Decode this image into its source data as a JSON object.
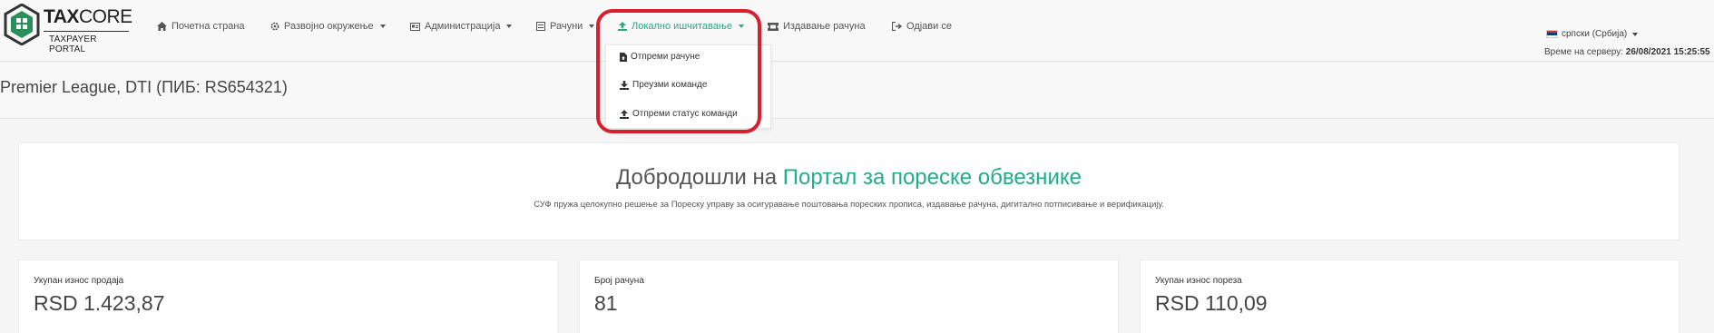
{
  "brand": {
    "title_bold": "TAX",
    "title_thin": "CORE",
    "subtitle": "TAXPAYER PORTAL",
    "logo_color": "#2b8f5a"
  },
  "nav": {
    "items": [
      {
        "label": "Почетна страна",
        "icon": "home-icon"
      },
      {
        "label": "Развојно окружење",
        "icon": "cog-icon",
        "has_caret": true
      },
      {
        "label": "Администрација",
        "icon": "id-card-icon",
        "has_caret": true
      },
      {
        "label": "Рачуни",
        "icon": "list-icon",
        "has_caret": true
      },
      {
        "label": "Локално ишчитавање",
        "icon": "upload-icon",
        "has_caret": true,
        "active": true
      },
      {
        "label": "Издавање рачуна",
        "icon": "ticket-icon"
      },
      {
        "label": "Одјави се",
        "icon": "sign-out-icon"
      }
    ],
    "active_color": "#2ea77a"
  },
  "language": {
    "label": "српски (Србија)",
    "flag": "serbian-flag-icon"
  },
  "server_time": {
    "label": "Време на серверу:",
    "value": "26/08/2021 15:25:55"
  },
  "dropdown": {
    "items": [
      {
        "label": "Отпреми рачуне",
        "icon": "file-upload-icon"
      },
      {
        "label": "Преузми команде",
        "icon": "download-icon"
      },
      {
        "label": "Отпреми статус команди",
        "icon": "upload-icon"
      }
    ],
    "highlight_color": "#d91f2e"
  },
  "company": {
    "name": "Premier League, DTI (ПИБ: RS654321)"
  },
  "welcome": {
    "title_prefix": "Добродошли на",
    "title_accent": "Портал за пореске обвезнике",
    "description": "СУФ пружа целокупно решење за Пореску управу за осигуравање поштовања пореских прописа, издавање рачуна, дигитално потписивање и верификацију.",
    "accent_color": "#1fae8a"
  },
  "stats": [
    {
      "label": "Укупан износ продаја",
      "value": "RSD 1.423,87"
    },
    {
      "label": "Број рачуна",
      "value": "81"
    },
    {
      "label": "Укупан износ пореза",
      "value": "RSD 110,09"
    }
  ]
}
